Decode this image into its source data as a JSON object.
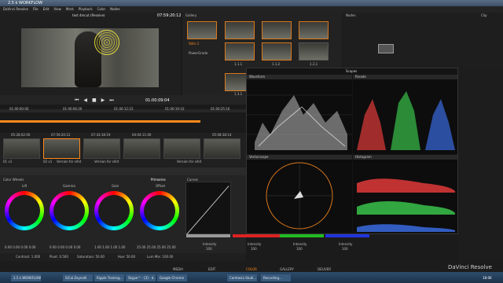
{
  "window": {
    "title": "2.5 k WORKFLOW"
  },
  "menu": [
    "DaVinci Resolve",
    "File",
    "Edit",
    "View",
    "Mark",
    "Playback",
    "Color",
    "Nodes"
  ],
  "viewer": {
    "clip_name": "test 4mcut (Resolve)",
    "timecode": "07:59:20:12"
  },
  "gallery": {
    "title": "Gallery",
    "items": [
      "Stills 1",
      "PowerGrade"
    ],
    "still_labels": [
      "1.1.1",
      "1.1.2",
      "1.2.1",
      "1.3.1"
    ]
  },
  "nodes": {
    "title": "Nodes"
  },
  "clip": {
    "title": "Clip"
  },
  "transport": {
    "timecode": "01:00:09:04"
  },
  "timeline": {
    "ruler": [
      "01:00:00:00",
      "01:00:06:26",
      "01:00:12:23",
      "01:00:19:10",
      "01:00:25:16"
    ],
    "clips": [
      {
        "tc": "05:28:02:00",
        "label": "01 v1"
      },
      {
        "tc": "07:59:20:12",
        "label": "02 v1"
      },
      {
        "tc": "07:43:18:19",
        "label": "03 v1"
      },
      {
        "tc": "04:04:11:00",
        "label": "04 v1"
      },
      {
        "tc": "05:08:38:14",
        "label": "05 v1"
      }
    ],
    "versions": [
      "Version for sihit",
      "Version for sihit",
      "Version for sihit"
    ]
  },
  "scopes": {
    "title": "Scopes",
    "panels": [
      "Waveform",
      "Parade",
      "Vectorscope",
      "Histogram"
    ]
  },
  "color_wheels": {
    "title": "Color Wheels",
    "tab": "Primaries",
    "wheels": [
      {
        "name": "Lift",
        "values": [
          "0.00",
          "0.00",
          "0.00",
          "0.00"
        ]
      },
      {
        "name": "Gamma",
        "values": [
          "0.00",
          "0.00",
          "0.00",
          "0.00"
        ]
      },
      {
        "name": "Gain",
        "values": [
          "1.00",
          "1.00",
          "1.00",
          "1.00"
        ]
      },
      {
        "name": "Offset",
        "values": [
          "25.00",
          "25.00",
          "25.00",
          "25.00"
        ]
      }
    ],
    "footer": {
      "contrast": "Contrast: 1.000",
      "pivot": "Pivot: 0.500",
      "saturation": "Saturation: 50.00",
      "hue": "Hue: 50.00",
      "lum_mix": "Lum Mix: 100.00"
    }
  },
  "curves": {
    "title": "Curves",
    "luminance": "Luminance",
    "intensity": "Intensity",
    "intensity_val": "100"
  },
  "bottom_tabs": [
    "MEDIA",
    "EDIT",
    "COLOR",
    "GALLERY",
    "DELIVER"
  ],
  "brand": "DaVinci Resolve",
  "taskbar": [
    "2.5 k WORKFLOW",
    "SiCal Zeynalli",
    "Ripple Training...",
    "Skype™ - [3] - d...",
    "Google Chrome",
    "Camtasia Studi...",
    "Recording..."
  ],
  "clock": "18:06",
  "colors": {
    "accent": "#ff8a1c",
    "waveform_green": "#39c24a",
    "waveform_red": "#e03a3a",
    "waveform_blue": "#3a6be0"
  }
}
